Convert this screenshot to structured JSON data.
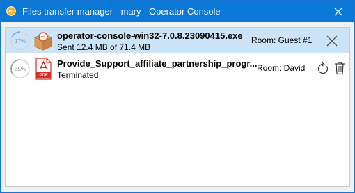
{
  "window": {
    "title": "Files transfer manager - mary - Operator Console"
  },
  "transfers": [
    {
      "progress_percent": 17,
      "progress_label": "17%",
      "file_name": "operator-console-win32-7.0.8.23090415.exe",
      "status": "Sent 12.4 MB of 71.4 MB",
      "room": "Room: Guest #1",
      "file_type_icon": "package-icon",
      "actions": [
        "close-icon"
      ],
      "selected": true
    },
    {
      "progress_percent": 35,
      "progress_label": "35%",
      "file_name": "Provide_Support_affiliate_partnership_progr...",
      "status": "Terminated",
      "room": "Room: David",
      "file_type_icon": "pdf-icon",
      "pdf_badge": "PDF",
      "actions": [
        "retry-icon",
        "trash-icon"
      ],
      "selected": false
    }
  ],
  "colors": {
    "titlebar": "#0a78d7",
    "selected_row": "#cce4f7",
    "progress_track": "#d6d6d6",
    "progress_fill_active": "#6aa8e0",
    "progress_fill_inactive": "#9a9a9a",
    "pdf_red": "#d82d24"
  }
}
